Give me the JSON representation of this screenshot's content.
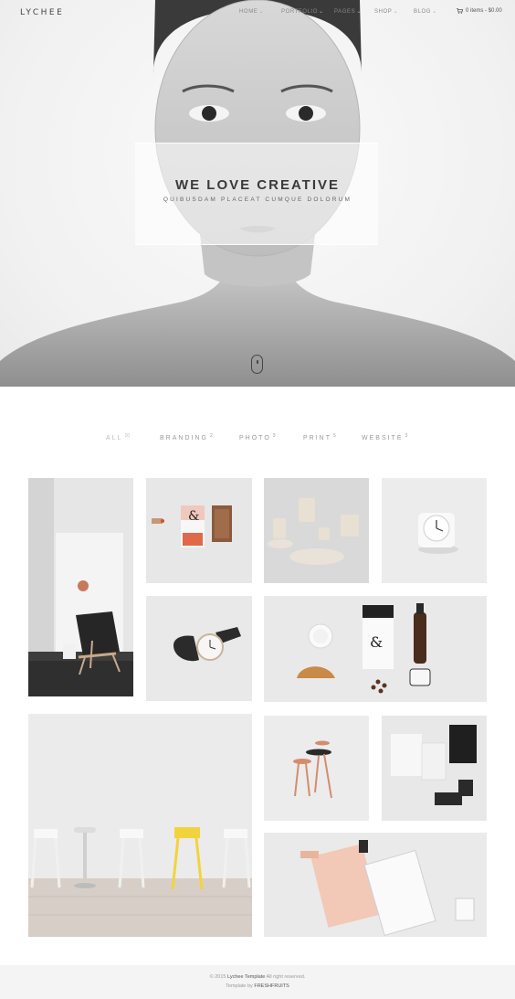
{
  "header": {
    "logo": "LYCHEE",
    "nav": [
      {
        "label": "HOME"
      },
      {
        "label": "PORTFOLIO"
      },
      {
        "label": "PAGES"
      },
      {
        "label": "SHOP"
      },
      {
        "label": "BLOG"
      }
    ],
    "cart": "0 items - $0.00"
  },
  "hero": {
    "title": "WE LOVE CREATIVE",
    "subtitle": "QUIBUSDAM PLACEAT CUMQUE DOLORUM"
  },
  "filters": [
    {
      "label": "ALL",
      "count": "10"
    },
    {
      "label": "BRANDING",
      "count": "2"
    },
    {
      "label": "PHOTO",
      "count": "3"
    },
    {
      "label": "PRINT",
      "count": "5"
    },
    {
      "label": "WEBSITE",
      "count": "3"
    }
  ],
  "footer": {
    "prefix": "© 2015",
    "brand": "Lychee Template",
    "suffix": "All right reserved.",
    "by_prefix": "Template by",
    "by": "FRESHFRUITS"
  },
  "icons": {
    "cart": "cart-icon",
    "scroll": "mouse-scroll-icon",
    "chevron": "chevron-down-icon"
  }
}
